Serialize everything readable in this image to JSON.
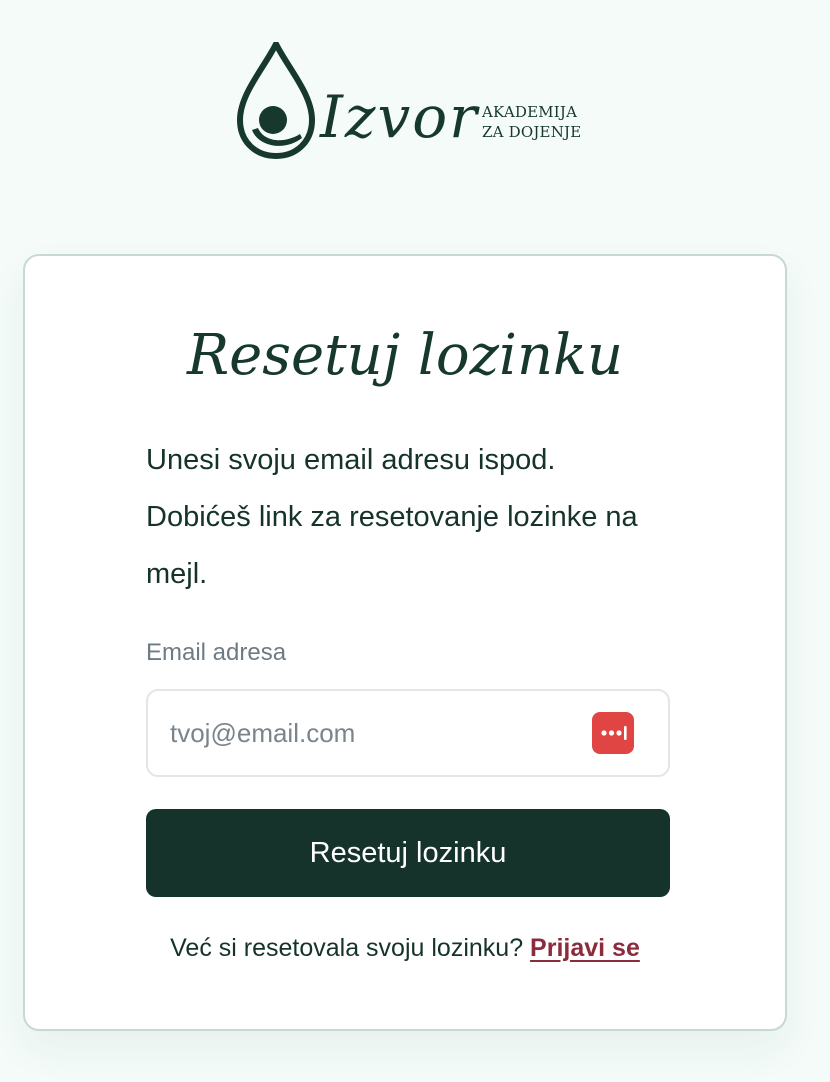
{
  "brand": {
    "name": "Izvor",
    "tagline_line1": "AKADEMIJA",
    "tagline_line2": "ZA DOJENJE"
  },
  "form": {
    "title": "Resetuj lozinku",
    "description": "Unesi svoju email adresu ispod. Dobićeš link za resetovanje lozinke na mejl.",
    "email_label": "Email adresa",
    "email_placeholder": "tvoj@email.com",
    "email_value": "",
    "submit_label": "Resetuj lozinku"
  },
  "footer": {
    "prompt": "Već si resetovala svoju lozinku?",
    "link_label": "Prijavi se"
  },
  "icons": {
    "logo": "drop-mother-child-icon",
    "password_manager": "password-manager-icon"
  },
  "colors": {
    "page_background": "#f4fbf8",
    "primary": "#15332b",
    "link": "#8b2b3c",
    "password_manager": "#e04543"
  }
}
